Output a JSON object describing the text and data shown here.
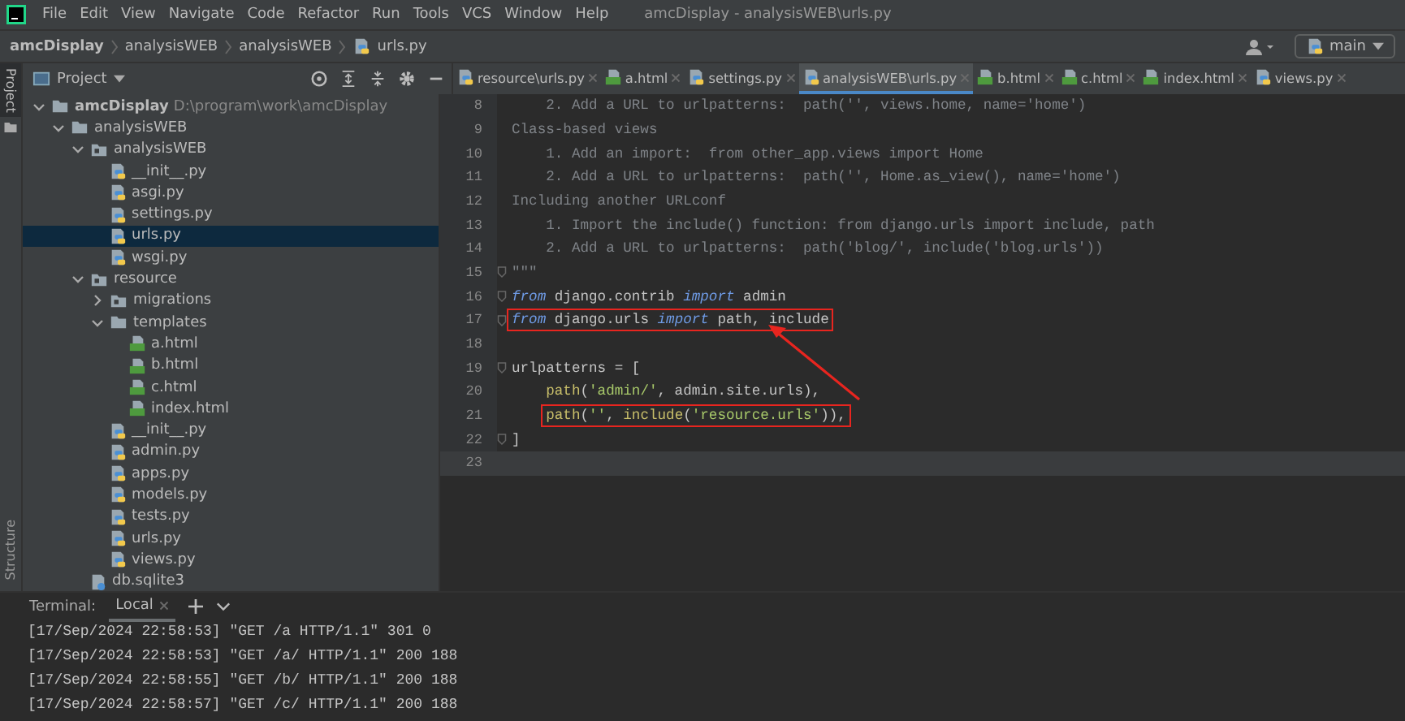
{
  "menu_bar": {
    "items": [
      "File",
      "Edit",
      "View",
      "Navigate",
      "Code",
      "Refactor",
      "Run",
      "Tools",
      "VCS",
      "Window",
      "Help"
    ],
    "title": "amcDisplay - analysisWEB\\urls.py"
  },
  "breadcrumb": [
    "amcDisplay",
    "analysisWEB",
    "analysisWEB",
    "urls.py"
  ],
  "run_config": "main",
  "side_strip": {
    "top": "Project",
    "bottom": "Structure"
  },
  "project_panel": {
    "title": "Project",
    "tree": [
      {
        "label": "amcDisplay",
        "path": "D:\\program\\work\\amcDisplay",
        "kind": "folder",
        "expanded": true,
        "selected": false,
        "children": [
          {
            "label": "analysisWEB",
            "kind": "folder",
            "expanded": true,
            "selected": false,
            "children": [
              {
                "label": "analysisWEB",
                "kind": "package",
                "expanded": true,
                "selected": false,
                "children": [
                  {
                    "label": "__init__.py",
                    "kind": "py",
                    "selected": false
                  },
                  {
                    "label": "asgi.py",
                    "kind": "py",
                    "selected": false
                  },
                  {
                    "label": "settings.py",
                    "kind": "py",
                    "selected": false
                  },
                  {
                    "label": "urls.py",
                    "kind": "py",
                    "selected": true
                  },
                  {
                    "label": "wsgi.py",
                    "kind": "py",
                    "selected": false
                  }
                ]
              },
              {
                "label": "resource",
                "kind": "package",
                "expanded": true,
                "selected": false,
                "children": [
                  {
                    "label": "migrations",
                    "kind": "package",
                    "expanded": false,
                    "selected": false
                  },
                  {
                    "label": "templates",
                    "kind": "folder",
                    "expanded": true,
                    "selected": false,
                    "children": [
                      {
                        "label": "a.html",
                        "kind": "html",
                        "selected": false
                      },
                      {
                        "label": "b.html",
                        "kind": "html",
                        "selected": false
                      },
                      {
                        "label": "c.html",
                        "kind": "html",
                        "selected": false
                      },
                      {
                        "label": "index.html",
                        "kind": "html",
                        "selected": false
                      }
                    ]
                  },
                  {
                    "label": "__init__.py",
                    "kind": "py",
                    "selected": false
                  },
                  {
                    "label": "admin.py",
                    "kind": "py",
                    "selected": false
                  },
                  {
                    "label": "apps.py",
                    "kind": "py",
                    "selected": false
                  },
                  {
                    "label": "models.py",
                    "kind": "py",
                    "selected": false
                  },
                  {
                    "label": "tests.py",
                    "kind": "py",
                    "selected": false
                  },
                  {
                    "label": "urls.py",
                    "kind": "py",
                    "selected": false
                  },
                  {
                    "label": "views.py",
                    "kind": "py",
                    "selected": false
                  }
                ]
              },
              {
                "label": "db.sqlite3",
                "kind": "db",
                "selected": false
              }
            ]
          }
        ]
      }
    ]
  },
  "tabs": [
    {
      "label": "resource\\urls.py",
      "kind": "py",
      "selected": false
    },
    {
      "label": "a.html",
      "kind": "html",
      "selected": false
    },
    {
      "label": "settings.py",
      "kind": "py",
      "selected": false
    },
    {
      "label": "analysisWEB\\urls.py",
      "kind": "py",
      "selected": true
    },
    {
      "label": "b.html",
      "kind": "html",
      "selected": false
    },
    {
      "label": "c.html",
      "kind": "html",
      "selected": false
    },
    {
      "label": "index.html",
      "kind": "html",
      "selected": false
    },
    {
      "label": "views.py",
      "kind": "py",
      "selected": false
    }
  ],
  "code_lines": [
    {
      "number": "8",
      "fold": false,
      "highlighted": false,
      "current": false,
      "indented": false,
      "segments": [
        {
          "kind": "comment",
          "text": "    2. Add a URL to urlpatterns:  path('', views.home, name='home')"
        }
      ]
    },
    {
      "number": "9",
      "fold": false,
      "highlighted": false,
      "current": false,
      "indented": false,
      "segments": [
        {
          "kind": "comment",
          "text": "Class-based views"
        }
      ]
    },
    {
      "number": "10",
      "fold": false,
      "highlighted": false,
      "current": false,
      "indented": false,
      "segments": [
        {
          "kind": "comment",
          "text": "    1. Add an import:  from other_app.views import Home"
        }
      ]
    },
    {
      "number": "11",
      "fold": false,
      "highlighted": false,
      "current": false,
      "indented": false,
      "segments": [
        {
          "kind": "comment",
          "text": "    2. Add a URL to urlpatterns:  path('', Home.as_view(), name='home')"
        }
      ]
    },
    {
      "number": "12",
      "fold": false,
      "highlighted": false,
      "current": false,
      "indented": false,
      "segments": [
        {
          "kind": "comment",
          "text": "Including another URLconf"
        }
      ]
    },
    {
      "number": "13",
      "fold": false,
      "highlighted": false,
      "current": false,
      "indented": false,
      "segments": [
        {
          "kind": "comment",
          "text": "    1. Import the include() function: from django.urls import include, path"
        }
      ]
    },
    {
      "number": "14",
      "fold": false,
      "highlighted": false,
      "current": false,
      "indented": false,
      "segments": [
        {
          "kind": "comment",
          "text": "    2. Add a URL to urlpatterns:  path('blog/', include('blog.urls'))"
        }
      ]
    },
    {
      "number": "15",
      "fold": true,
      "highlighted": false,
      "current": false,
      "indented": false,
      "segments": [
        {
          "kind": "comment",
          "text": "\"\"\""
        }
      ]
    },
    {
      "number": "16",
      "fold": true,
      "highlighted": false,
      "current": false,
      "indented": false,
      "segments": [
        {
          "kind": "keyword",
          "text": "from"
        },
        {
          "kind": "plain",
          "text": " django.contrib "
        },
        {
          "kind": "keyword",
          "text": "import"
        },
        {
          "kind": "plain",
          "text": " admin"
        }
      ]
    },
    {
      "number": "17",
      "fold": true,
      "highlighted": true,
      "current": false,
      "indented": false,
      "segments": [
        {
          "kind": "keyword",
          "text": "from"
        },
        {
          "kind": "plain",
          "text": " django.urls "
        },
        {
          "kind": "keyword",
          "text": "import"
        },
        {
          "kind": "plain",
          "text": " path, include"
        }
      ]
    },
    {
      "number": "18",
      "fold": false,
      "highlighted": false,
      "current": false
    },
    {
      "number": "19",
      "fold": true,
      "highlighted": false,
      "current": false,
      "indented": false,
      "segments": [
        {
          "kind": "plain",
          "text": "urlpatterns = ["
        }
      ]
    },
    {
      "number": "20",
      "fold": false,
      "highlighted": false,
      "current": false,
      "indented": true,
      "segments": [
        {
          "kind": "function",
          "text": "path"
        },
        {
          "kind": "plain",
          "text": "("
        },
        {
          "kind": "string",
          "text": "'admin/'"
        },
        {
          "kind": "plain",
          "text": ", admin.site.urls),"
        }
      ]
    },
    {
      "number": "21",
      "fold": false,
      "highlighted": true,
      "current": false,
      "indented": true,
      "segments": [
        {
          "kind": "function",
          "text": "path"
        },
        {
          "kind": "plain",
          "text": "("
        },
        {
          "kind": "string",
          "text": "''"
        },
        {
          "kind": "plain",
          "text": ", "
        },
        {
          "kind": "function",
          "text": "include"
        },
        {
          "kind": "plain",
          "text": "("
        },
        {
          "kind": "string",
          "text": "'resource.urls'"
        },
        {
          "kind": "plain",
          "text": ")),"
        }
      ]
    },
    {
      "number": "22",
      "fold": true,
      "highlighted": false,
      "current": false,
      "indented": false,
      "segments": [
        {
          "kind": "plain",
          "text": "]"
        }
      ]
    },
    {
      "number": "23",
      "fold": false,
      "highlighted": false,
      "current": true
    }
  ],
  "terminal": {
    "label": "Terminal:",
    "tabs": [
      {
        "label": "Local",
        "selected": true
      }
    ],
    "lines": [
      "[17/Sep/2024 22:58:53] \"GET /a HTTP/1.1\" 301 0",
      "[17/Sep/2024 22:58:53] \"GET /a/ HTTP/1.1\" 200 188",
      "[17/Sep/2024 22:58:55] \"GET /b/ HTTP/1.1\" 200 188",
      "[17/Sep/2024 22:58:57] \"GET /c/ HTTP/1.1\" 200 188"
    ]
  }
}
